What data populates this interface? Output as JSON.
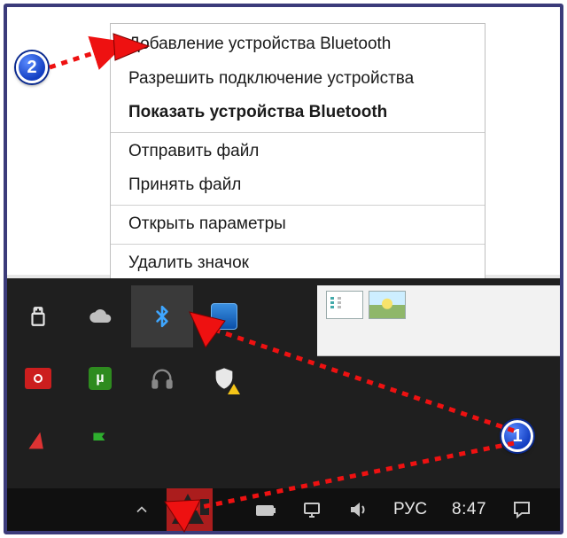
{
  "menu": {
    "add_device": "Добавление устройства Bluetooth",
    "allow_connect": "Разрешить подключение устройства",
    "show_devices": "Показать устройства Bluetooth",
    "send_file": "Отправить файл",
    "receive_file": "Принять файл",
    "open_settings": "Открыть параметры",
    "remove_icon": "Удалить значок"
  },
  "tray_icons": {
    "usb": "usb-icon",
    "cloud": "onedrive-icon",
    "bluetooth": "bluetooth-icon",
    "intel": "intel-graphics-icon",
    "camera": "camera-icon",
    "utorrent": "utorrent-icon",
    "headphones": "headphones-icon",
    "security": "security-warning-icon",
    "triangle": "triangle-icon",
    "flag": "flag-icon"
  },
  "taskbar": {
    "language": "РУС",
    "clock": "8:47"
  },
  "badges": {
    "one": "1",
    "two": "2"
  }
}
